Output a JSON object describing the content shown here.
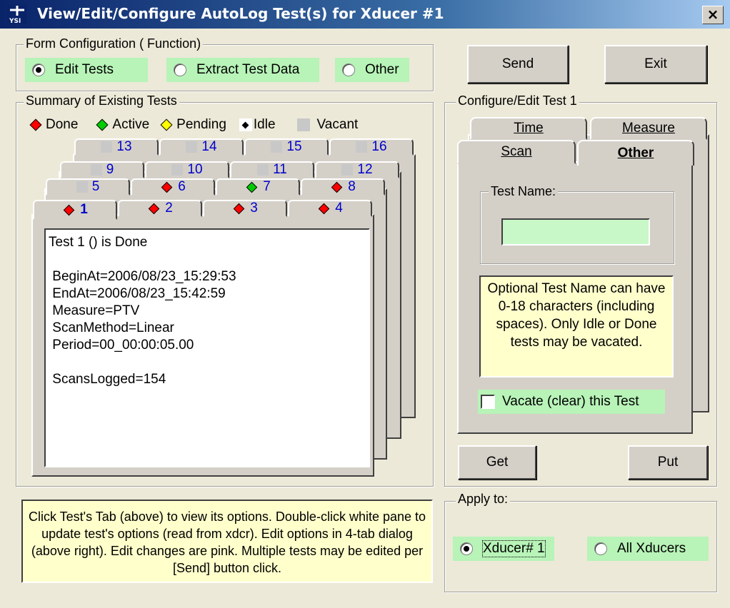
{
  "window": {
    "title": "View/Edit/Configure AutoLog Test(s) for Xducer #1",
    "close": "×"
  },
  "form_config": {
    "legend": "Form Configuration ( Function)",
    "options": [
      {
        "label": "Edit Tests",
        "selected": true
      },
      {
        "label": "Extract Test Data",
        "selected": false
      },
      {
        "label": "Other",
        "selected": false
      }
    ]
  },
  "buttons": {
    "send": "Send",
    "exit": "Exit",
    "get": "Get",
    "put": "Put"
  },
  "summary": {
    "legend": "Summary of Existing Tests",
    "status_legend": [
      "Done",
      "Active",
      "Pending",
      "Idle",
      "Vacant"
    ],
    "status_colors": {
      "Done": "#ff0000",
      "Active": "#00cc00",
      "Pending": "#ffff00",
      "Idle": "#000000",
      "Vacant": "#c8c8c8"
    },
    "tabs": [
      {
        "num": "1",
        "status": "Done"
      },
      {
        "num": "2",
        "status": "Done"
      },
      {
        "num": "3",
        "status": "Done"
      },
      {
        "num": "4",
        "status": "Done"
      },
      {
        "num": "5",
        "status": "Vacant"
      },
      {
        "num": "6",
        "status": "Done"
      },
      {
        "num": "7",
        "status": "Active"
      },
      {
        "num": "8",
        "status": "Done"
      },
      {
        "num": "9",
        "status": "Vacant"
      },
      {
        "num": "10",
        "status": "Vacant"
      },
      {
        "num": "11",
        "status": "Vacant"
      },
      {
        "num": "12",
        "status": "Vacant"
      },
      {
        "num": "13",
        "status": "Vacant"
      },
      {
        "num": "14",
        "status": "Vacant"
      },
      {
        "num": "15",
        "status": "Vacant"
      },
      {
        "num": "16",
        "status": "Vacant"
      }
    ],
    "detail_lines": [
      "Test 1 () is Done",
      "",
      " BeginAt=2006/08/23_15:29:53",
      " EndAt=2006/08/23_15:42:59",
      " Measure=PTV",
      " ScanMethod=Linear",
      " Period=00_00:00:05.00",
      "",
      " ScansLogged=154"
    ]
  },
  "help_note": "Click Test's Tab (above) to view its options.  Double-click white pane to update test's options (read from xdcr).  Edit options in 4-tab dialog (above right).  Edit changes are pink. Multiple tests may be edited per [Send] button click.",
  "config": {
    "legend": "Configure/Edit Test 1",
    "tabs": {
      "time": "Time",
      "measure": "Measure",
      "scan": "Scan",
      "other": "Other"
    },
    "test_name_legend": "Test Name:",
    "test_name_value": "",
    "info": "Optional Test Name can have 0-18 characters (including spaces).  Only Idle or Done tests may be vacated.",
    "vacate_label": "Vacate (clear) this Test",
    "vacate_checked": false
  },
  "apply": {
    "legend": "Apply to:",
    "options": [
      {
        "label": "Xducer# 1",
        "selected": true
      },
      {
        "label": "All Xducers",
        "selected": false
      }
    ]
  }
}
